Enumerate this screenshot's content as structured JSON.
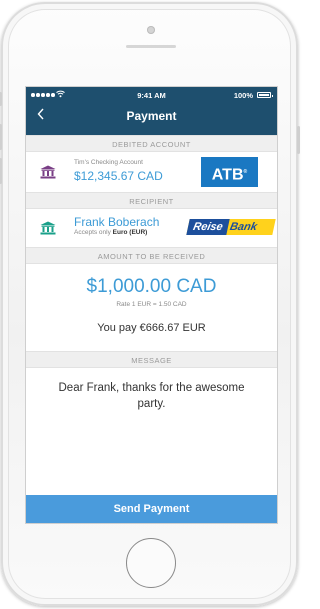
{
  "status_bar": {
    "time": "9:41 AM",
    "battery": "100%"
  },
  "nav": {
    "title": "Payment"
  },
  "debited": {
    "header": "DEBITED ACCOUNT",
    "account_name": "Tim's Checking Account",
    "amount": "$12,345.67 CAD",
    "bank_logo": "ATB",
    "bank_logo_mark": "®"
  },
  "recipient": {
    "header": "RECIPIENT",
    "name": "Frank Boberach",
    "accepts_prefix": "Accepts only",
    "accepts_currency": "Euro (EUR)",
    "bank_logo_part1": "Reise",
    "bank_logo_part2": "Bank"
  },
  "amount": {
    "header": "AMOUNT TO BE RECEIVED",
    "value": "$1,000.00 CAD",
    "rate": "Rate 1 EUR = 1.50 CAD",
    "you_pay": "You pay €666.67 EUR"
  },
  "message": {
    "header": "MESSAGE",
    "text": "Dear Frank, thanks for the awesome party."
  },
  "actions": {
    "send_label": "Send Payment"
  },
  "colors": {
    "nav_bg": "#1e4f6e",
    "accent": "#3d9bd6",
    "send_bg": "#4a9bdc",
    "bank_icon_purple": "#7a3f86",
    "bank_icon_teal": "#1aa08a"
  },
  "icons": {
    "back": "chevron-left-icon",
    "debited_bank": "bank-building-icon",
    "recipient_bank": "bank-building-icon"
  }
}
